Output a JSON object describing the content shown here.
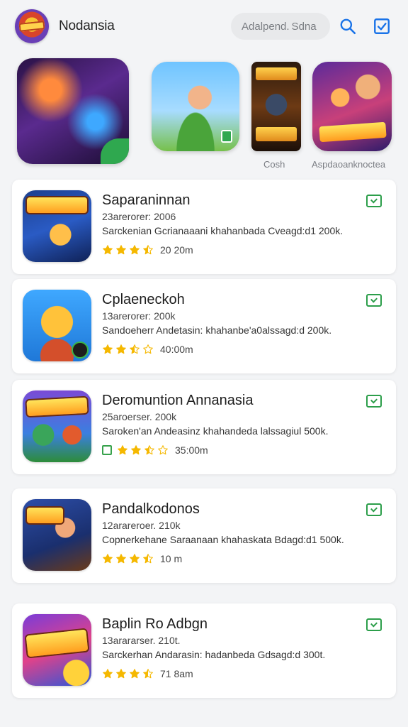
{
  "header": {
    "app_name": "Nodansia",
    "search_label": "Adalpend. Sdna",
    "icons": {
      "search": "search-icon",
      "checkbox": "checkbox-icon"
    }
  },
  "featured": {
    "captions": [
      "Cosh",
      "Aspdaoanknoctea"
    ]
  },
  "colors": {
    "accent": "#2c9e4a",
    "star": "#f5b800",
    "link": "#1a73e8"
  },
  "list": [
    {
      "title": "Saparaninnan",
      "meta": "23arerorer: 2006",
      "desc": "Sarckenian Gcrianaaani khahanbada Cveagd:d1 200k.",
      "rating": "20 20m",
      "stars": 3.5
    },
    {
      "title": "Cplaeneckoh",
      "meta": "13arerorer: 200k",
      "desc": "Sandoeherr Andetasin: khahanbe'a0alssagd:d 200k.",
      "rating": "40:00m",
      "stars": 2.5
    },
    {
      "title": "Deromuntion Annanasia",
      "meta": "25aroerser. 200k",
      "desc": "Saroken'an Andeasinz khahandeda lalssagiul 500k.",
      "rating": "35:00m",
      "stars": 2.5
    },
    {
      "title": "Pandalkodonos",
      "meta": "12arareroer. 210k",
      "desc": "Copnerkehane Saraanaan khahaskata Bdagd:d1 500k.",
      "rating": "10 m",
      "stars": 3.5
    },
    {
      "title": "Baplin Ro Adbgn",
      "meta": "13arararser. 210t.",
      "desc": "Sarckerhan Andarasin: hadanbeda Gdsagd:d 300t.",
      "rating": "71 8am",
      "stars": 3.5
    }
  ]
}
